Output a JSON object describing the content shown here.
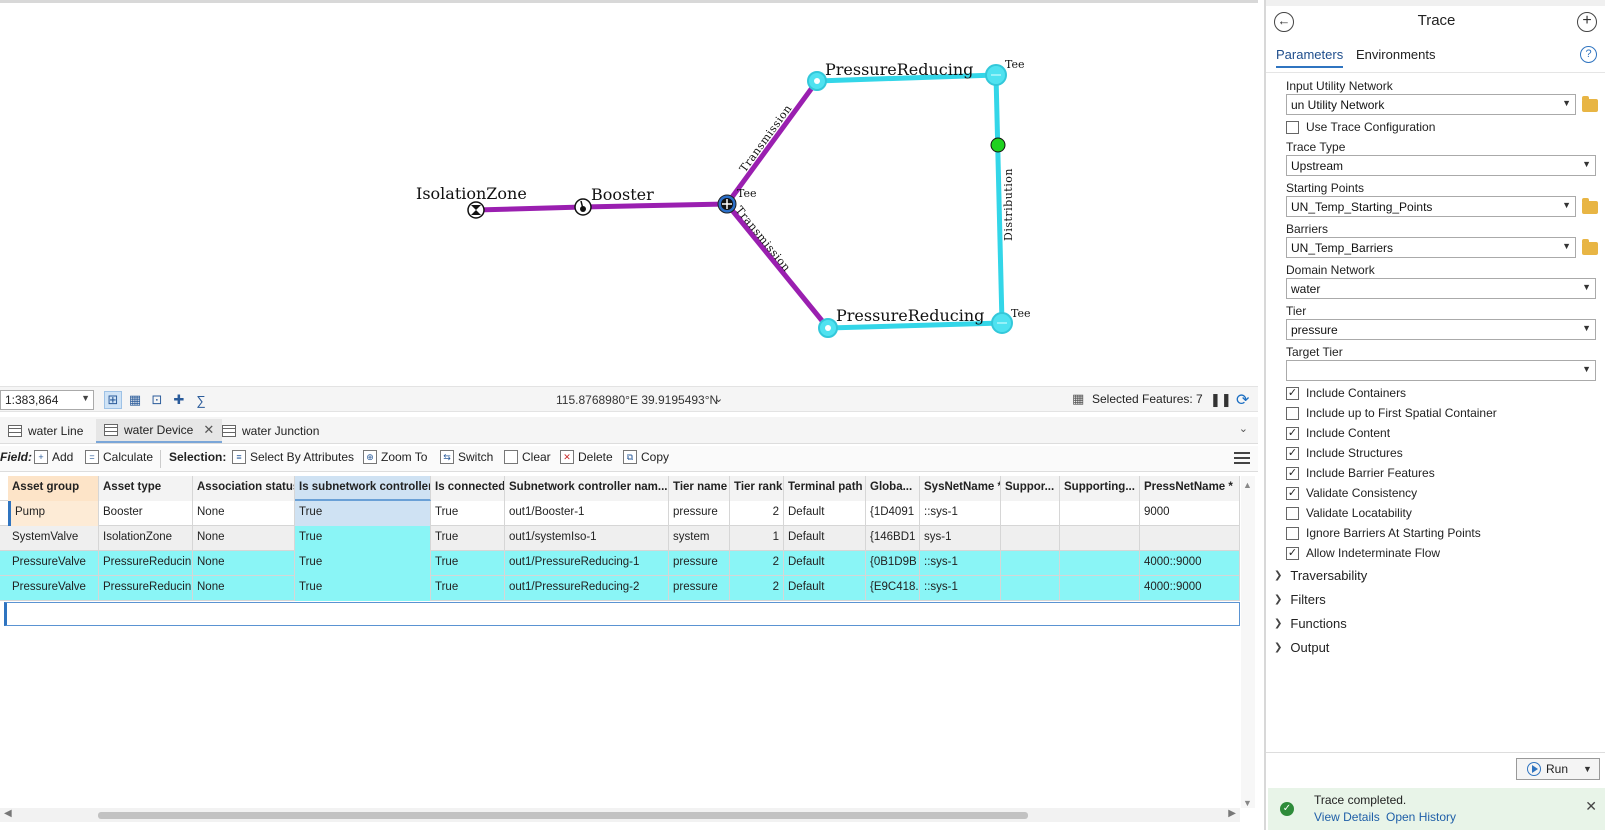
{
  "map": {
    "labels": {
      "isolation_zone": "IsolationZone",
      "booster": "Booster",
      "pressure_reducing_top": "PressureReducing",
      "pressure_reducing_bottom": "PressureReducing",
      "tee_center": "Tee",
      "tee_top_right": "Tee",
      "tee_bottom_right": "Tee",
      "transmission_upper": "Transmission",
      "transmission_lower": "Transmission",
      "distribution": "Distribution"
    },
    "colors": {
      "transmission": "#9a1fb0",
      "distribution": "#33d6e8",
      "flag": "#1fd11f"
    }
  },
  "mapbar": {
    "scale": "1:383,864",
    "coordinates": "115.8768980°E 39.9195493°N",
    "selected_features": "Selected Features: 7"
  },
  "tabs": [
    {
      "label": "water Line"
    },
    {
      "label": "water Device"
    },
    {
      "label": "water Junction"
    }
  ],
  "toolbar": {
    "field": "Field:",
    "add": "Add",
    "calculate": "Calculate",
    "selection": "Selection:",
    "select_by_attributes": "Select By Attributes",
    "zoom_to": "Zoom To",
    "switch": "Switch",
    "clear": "Clear",
    "delete": "Delete",
    "copy": "Copy"
  },
  "table": {
    "columns": [
      "Asset group",
      "Asset type",
      "Association status",
      "Is subnetwork controller",
      "Is connected",
      "Subnetwork controller nam...",
      "Tier name",
      "Tier rank",
      "Terminal path",
      "Globa...",
      "SysNetName *",
      "Suppor...",
      "Supporting...",
      "PressNetName *"
    ],
    "rows": [
      [
        "Pump",
        "Booster",
        "None",
        "True",
        "True",
        "out1/Booster-1",
        "pressure",
        "2",
        "Default",
        "{1D4091",
        "::sys-1",
        "",
        "",
        "9000"
      ],
      [
        "SystemValve",
        "IsolationZone",
        "None",
        "True",
        "True",
        "out1/systemIso-1",
        "system",
        "1",
        "Default",
        "{146BD1",
        "sys-1",
        "",
        "",
        ""
      ],
      [
        "PressureValve",
        "PressureReducin",
        "None",
        "True",
        "True",
        "out1/PressureReducing-1",
        "pressure",
        "2",
        "Default",
        "{0B1D9B",
        "::sys-1",
        "",
        "",
        "4000::9000"
      ],
      [
        "PressureValve",
        "PressureReducin",
        "None",
        "True",
        "True",
        "out1/PressureReducing-2",
        "pressure",
        "2",
        "Default",
        "{E9C418.",
        "::sys-1",
        "",
        "",
        "4000::9000"
      ]
    ]
  },
  "pane": {
    "title": "Trace",
    "tab_parameters": "Parameters",
    "tab_environments": "Environments",
    "input_utility_network_label": "Input Utility Network",
    "input_utility_network_value": "un Utility Network",
    "use_trace_configuration": "Use Trace Configuration",
    "trace_type_label": "Trace Type",
    "trace_type_value": "Upstream",
    "starting_points_label": "Starting Points",
    "starting_points_value": "UN_Temp_Starting_Points",
    "barriers_label": "Barriers",
    "barriers_value": "UN_Temp_Barriers",
    "domain_network_label": "Domain Network",
    "domain_network_value": "water",
    "tier_label": "Tier",
    "tier_value": "pressure",
    "target_tier_label": "Target Tier",
    "target_tier_value": "",
    "checks": [
      {
        "label": "Include Containers",
        "checked": true
      },
      {
        "label": "Include up to First Spatial Container",
        "checked": false
      },
      {
        "label": "Include Content",
        "checked": true
      },
      {
        "label": "Include Structures",
        "checked": true
      },
      {
        "label": "Include Barrier Features",
        "checked": true
      },
      {
        "label": "Validate Consistency",
        "checked": true
      },
      {
        "label": "Validate Locatability",
        "checked": false
      },
      {
        "label": "Ignore Barriers At Starting Points",
        "checked": false
      },
      {
        "label": "Allow Indeterminate Flow",
        "checked": true
      }
    ],
    "sections": [
      "Traversability",
      "Filters",
      "Functions",
      "Output"
    ],
    "run": "Run",
    "message": "Trace completed.",
    "view_details": "View Details",
    "open_history": "Open History"
  }
}
